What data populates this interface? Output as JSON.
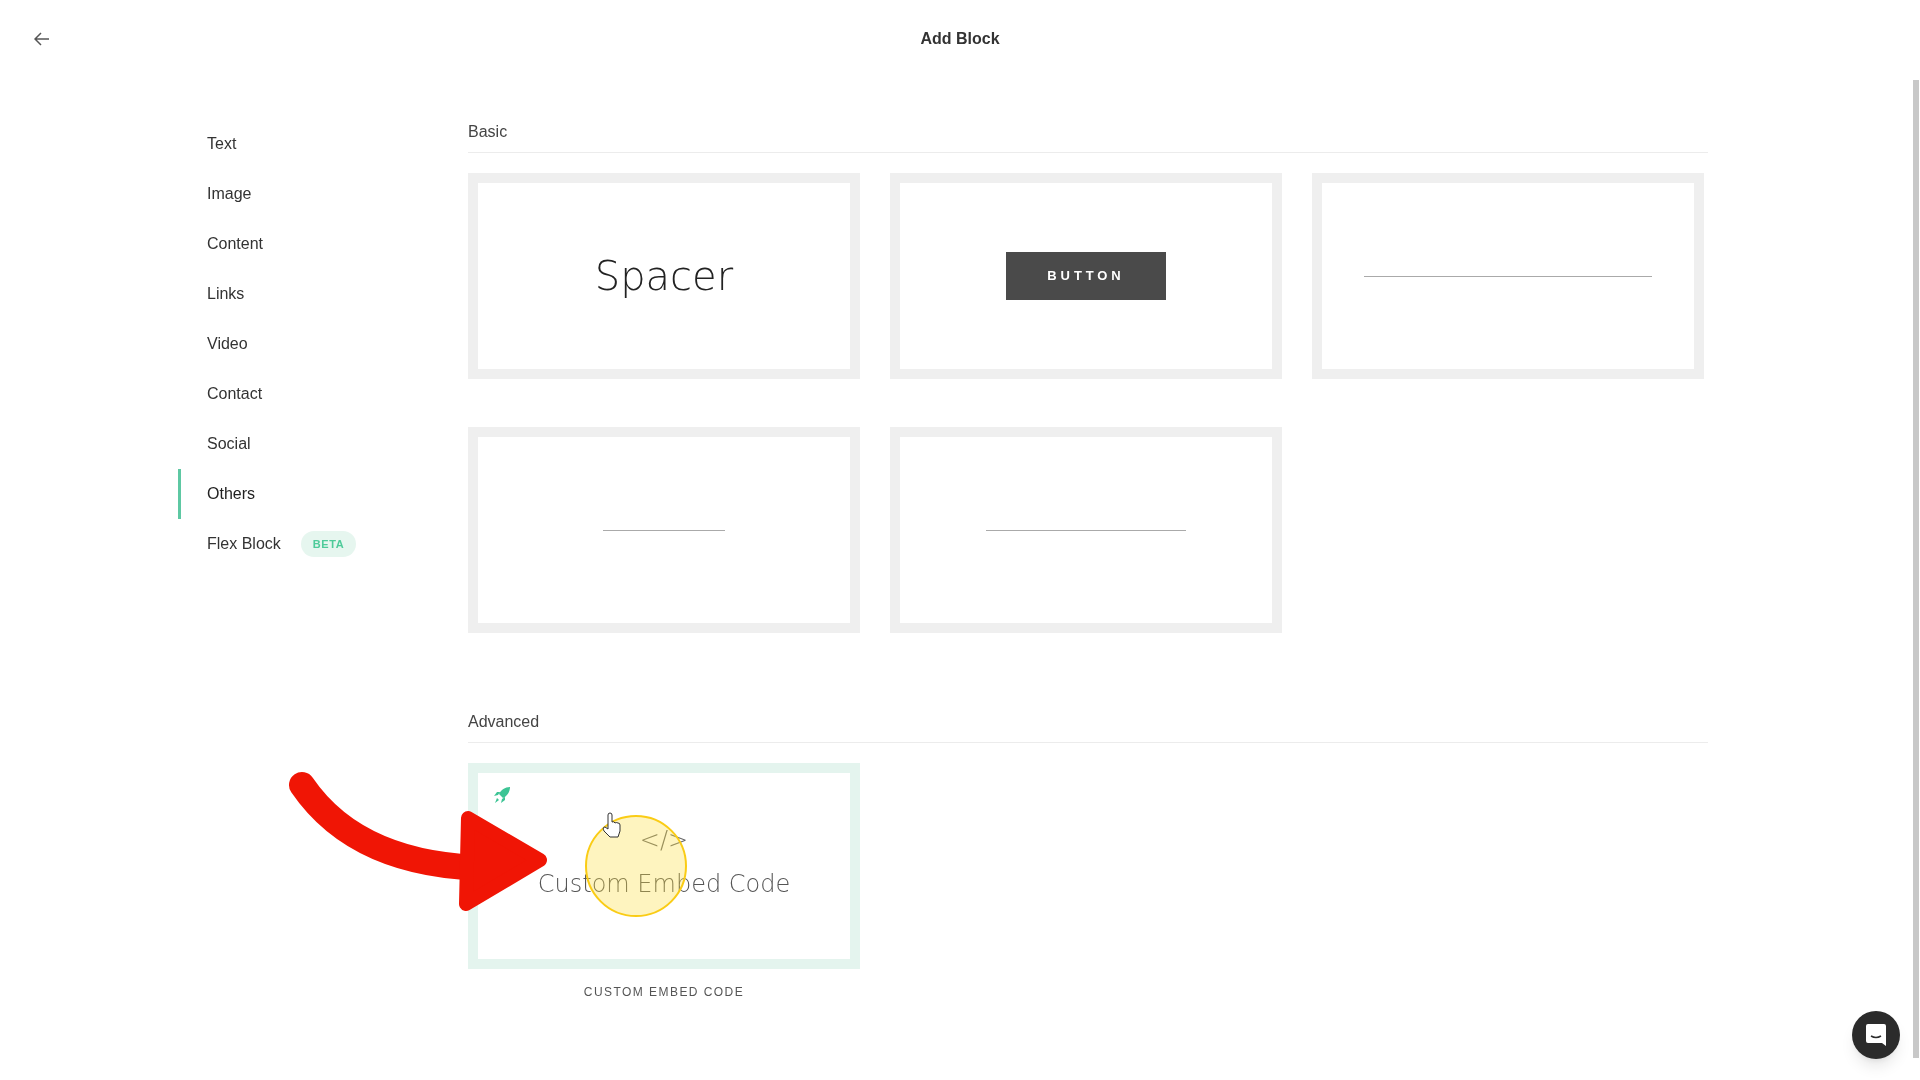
{
  "header": {
    "title": "Add Block"
  },
  "sidebar": {
    "items": [
      {
        "label": "Text",
        "selected": false
      },
      {
        "label": "Image",
        "selected": false
      },
      {
        "label": "Content",
        "selected": false
      },
      {
        "label": "Links",
        "selected": false
      },
      {
        "label": "Video",
        "selected": false
      },
      {
        "label": "Contact",
        "selected": false
      },
      {
        "label": "Social",
        "selected": false
      },
      {
        "label": "Others",
        "selected": true
      },
      {
        "label": "Flex Block",
        "selected": false,
        "badge": "BETA"
      }
    ]
  },
  "sections": [
    {
      "title": "Basic",
      "blocks": [
        {
          "kind": "spacer",
          "text": "Spacer"
        },
        {
          "kind": "button",
          "text": "BUTTON"
        },
        {
          "kind": "wide_rule"
        },
        {
          "kind": "short_rule"
        },
        {
          "kind": "medium_rule"
        }
      ]
    },
    {
      "title": "Advanced",
      "blocks": [
        {
          "kind": "embed",
          "symbol": "</>",
          "text": "Custom Embed Code",
          "caption": "CUSTOM EMBED CODE",
          "highlighted": true
        }
      ]
    }
  ]
}
